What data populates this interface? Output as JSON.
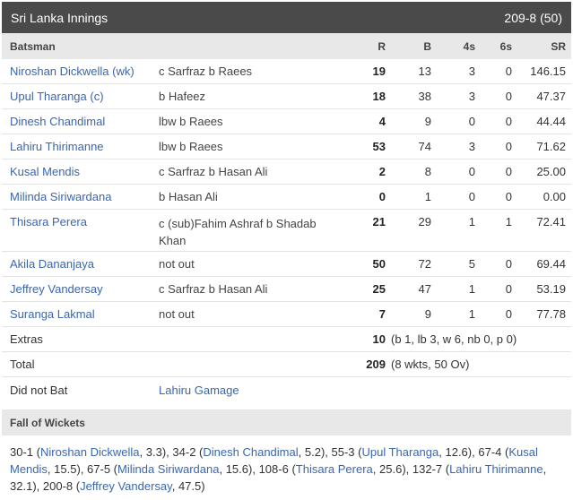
{
  "header": {
    "title": "Sri Lanka Innings",
    "score": "209-8 (50)"
  },
  "columns": {
    "batsman": "Batsman",
    "r": "R",
    "b": "B",
    "fours": "4s",
    "sixes": "6s",
    "sr": "SR"
  },
  "batsmen": [
    {
      "name": "Niroshan Dickwella (wk)",
      "dismissal": "c Sarfraz b Raees",
      "r": "19",
      "b": "13",
      "fours": "3",
      "sixes": "0",
      "sr": "146.15"
    },
    {
      "name": "Upul Tharanga (c)",
      "dismissal": "b Hafeez",
      "r": "18",
      "b": "38",
      "fours": "3",
      "sixes": "0",
      "sr": "47.37"
    },
    {
      "name": "Dinesh Chandimal",
      "dismissal": "lbw b Raees",
      "r": "4",
      "b": "9",
      "fours": "0",
      "sixes": "0",
      "sr": "44.44"
    },
    {
      "name": "Lahiru Thirimanne",
      "dismissal": "lbw b Raees",
      "r": "53",
      "b": "74",
      "fours": "3",
      "sixes": "0",
      "sr": "71.62"
    },
    {
      "name": "Kusal Mendis",
      "dismissal": "c Sarfraz b Hasan Ali",
      "r": "2",
      "b": "8",
      "fours": "0",
      "sixes": "0",
      "sr": "25.00"
    },
    {
      "name": "Milinda Siriwardana",
      "dismissal": "b Hasan Ali",
      "r": "0",
      "b": "1",
      "fours": "0",
      "sixes": "0",
      "sr": "0.00"
    },
    {
      "name": "Thisara Perera",
      "dismissal": "c (sub)Fahim Ashraf b Shadab Khan",
      "r": "21",
      "b": "29",
      "fours": "1",
      "sixes": "1",
      "sr": "72.41"
    },
    {
      "name": "Akila Dananjaya",
      "dismissal": "not out",
      "r": "50",
      "b": "72",
      "fours": "5",
      "sixes": "0",
      "sr": "69.44"
    },
    {
      "name": "Jeffrey Vandersay",
      "dismissal": "c Sarfraz b Hasan Ali",
      "r": "25",
      "b": "47",
      "fours": "1",
      "sixes": "0",
      "sr": "53.19"
    },
    {
      "name": "Suranga Lakmal",
      "dismissal": "not out",
      "r": "7",
      "b": "9",
      "fours": "1",
      "sixes": "0",
      "sr": "77.78"
    }
  ],
  "extras": {
    "label": "Extras",
    "value": "10",
    "detail": "(b 1, lb 3, w 6, nb 0, p 0)"
  },
  "total": {
    "label": "Total",
    "value": "209",
    "detail": "(8 wkts, 50 Ov)"
  },
  "did_not_bat": {
    "label": "Did not Bat",
    "player": "Lahiru Gamage"
  },
  "fall_of_wickets": {
    "title": "Fall of Wickets",
    "items": [
      {
        "score": "30-1",
        "player": "Niroshan Dickwella",
        "over": "3.3"
      },
      {
        "score": "34-2",
        "player": "Dinesh Chandimal",
        "over": "5.2"
      },
      {
        "score": "55-3",
        "player": "Upul Tharanga",
        "over": "12.6"
      },
      {
        "score": "67-4",
        "player": "Kusal Mendis",
        "over": "15.5"
      },
      {
        "score": "67-5",
        "player": "Milinda Siriwardana",
        "over": "15.6"
      },
      {
        "score": "108-6",
        "player": "Thisara Perera",
        "over": "25.6"
      },
      {
        "score": "132-7",
        "player": "Lahiru Thirimanne",
        "over": "32.1"
      },
      {
        "score": "200-8",
        "player": "Jeffrey Vandersay",
        "over": "47.5"
      }
    ]
  },
  "colors": {
    "header_bg": "#4a4a4a",
    "subheader_bg": "#e8e8e8",
    "link": "#3a66b0"
  }
}
